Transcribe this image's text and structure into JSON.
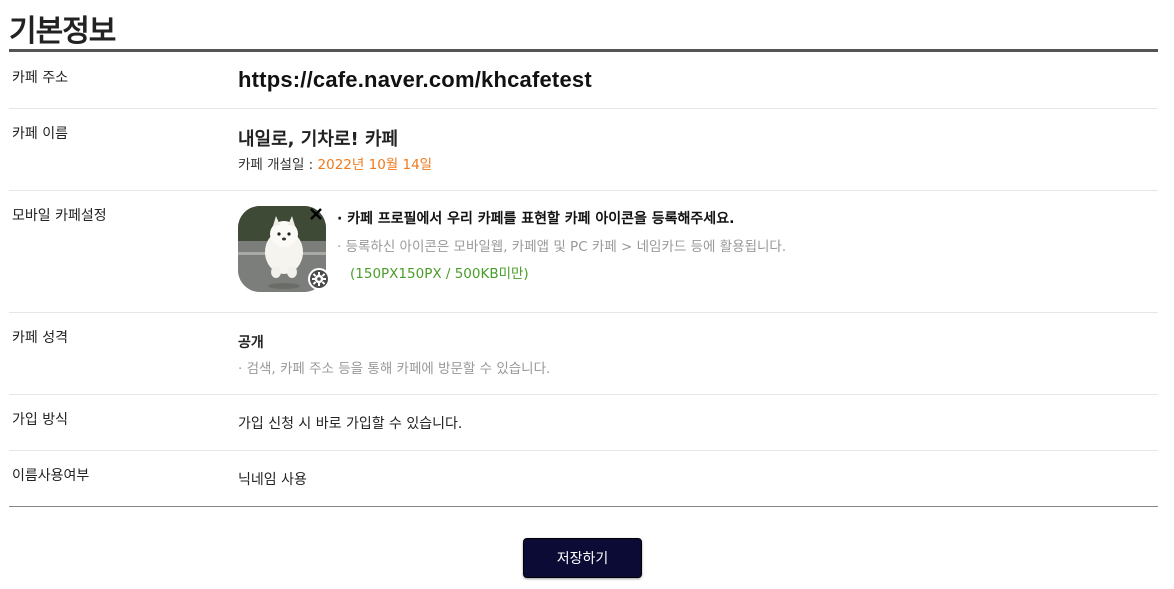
{
  "page": {
    "title": "기본정보"
  },
  "rows": {
    "url": {
      "label": "카페 주소",
      "value": "https://cafe.naver.com/khcafetest"
    },
    "name": {
      "label": "카페 이름",
      "value": "내일로, 기차로! 카페",
      "open_date_label": "카페 개설일 : ",
      "open_date_value": "2022년 10월 14일"
    },
    "mobile": {
      "label": "모바일 카페설정",
      "main_text": "· 카페 프로필에서 우리 카페를 표현할 카페 아이콘을 등록해주세요.",
      "desc_text": "· 등록하신 아이콘은 모바일웹, 카페앱 및 PC 카페 > 네임카드 등에 활용됩니다.",
      "spec_text": "(150PX150PX / 500KB미만)",
      "icon_name": "cafe-icon-image"
    },
    "type": {
      "label": "카페 성격",
      "value": "공개",
      "desc": "· 검색, 카페 주소 등을 통해 카페에 방문할 수 있습니다."
    },
    "join": {
      "label": "가입 방식",
      "value": "가입 신청 시 바로 가입할 수 있습니다."
    },
    "nickname": {
      "label": "이름사용여부",
      "value": "닉네임 사용"
    }
  },
  "actions": {
    "save_label": "저장하기"
  },
  "colors": {
    "accent_date": "#f07a1e",
    "spec_green": "#4a9d2a",
    "save_button": "#0c0b36"
  }
}
